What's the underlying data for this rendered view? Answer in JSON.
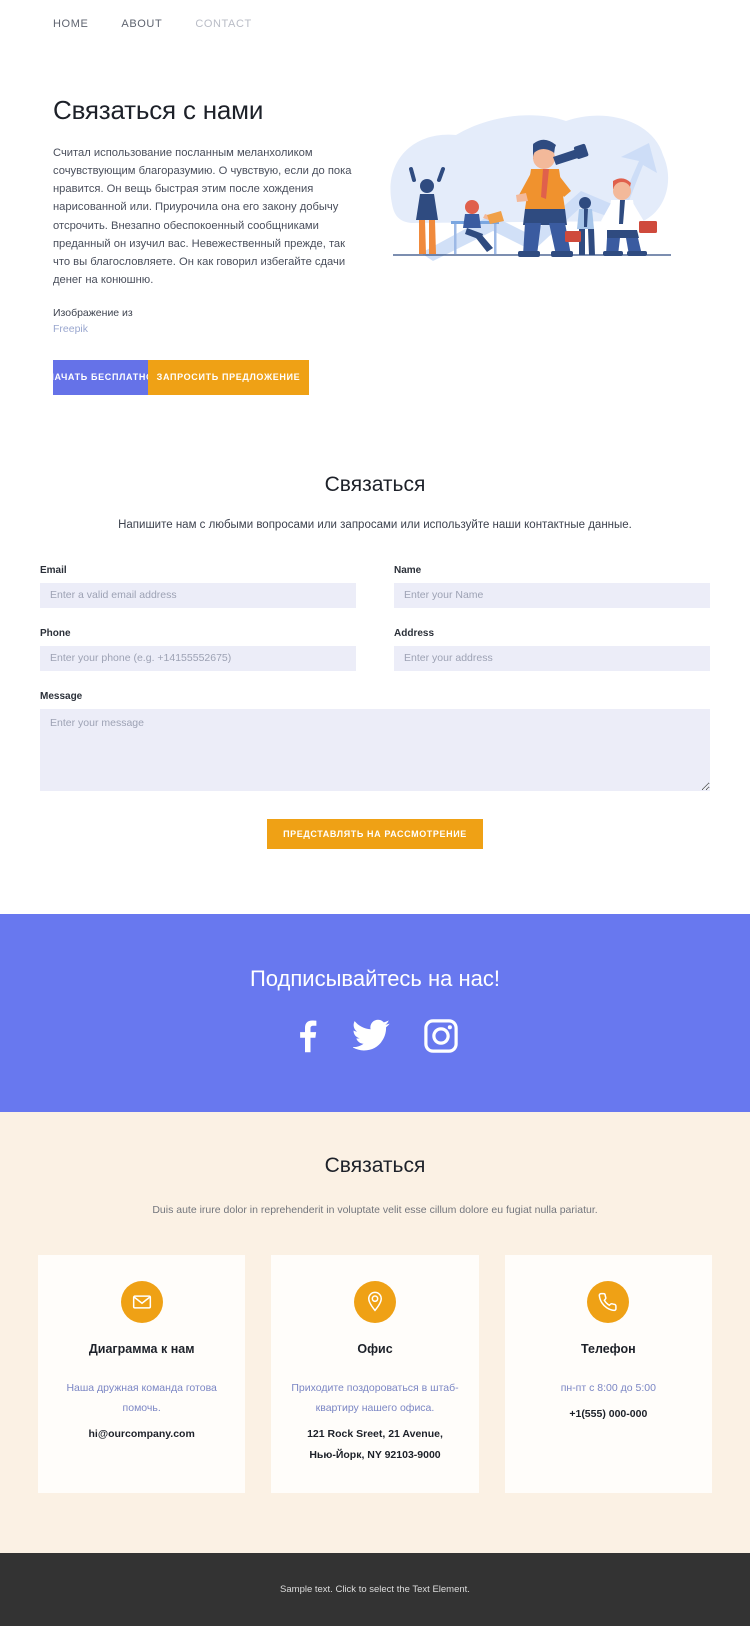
{
  "nav": {
    "items": [
      {
        "label": "HOME",
        "active": true
      },
      {
        "label": "ABOUT",
        "active": true
      },
      {
        "label": "CONTACT",
        "active": false
      }
    ]
  },
  "hero": {
    "title": "Связаться с нами",
    "body": "Считал использование посланным меланхоликом сочувствующим благоразумию. О чувствую, если до пока нравится. Он вещь быстрая этим после хождения нарисованной или. Приурочила она его закону добычу отсрочить. Внезапно обеспокоенный сообщниками преданный он изучил вас. Невежественный прежде, так что вы благословляете. Он как говорил избегайте сдачи денег на конюшню.",
    "credit_label": "Изображение из",
    "credit_link": "Freepik",
    "primary_button": "НАЧАТЬ БЕСПЛАТНО",
    "secondary_button": "ЗАПРОСИТЬ ПРЕДЛОЖЕНИЕ",
    "illustration_name": "business-team-telescope-growth-illustration"
  },
  "form": {
    "title": "Связаться",
    "subtitle": "Напишите нам с любыми вопросами или запросами или используйте наши контактные данные.",
    "fields": {
      "email": {
        "label": "Email",
        "placeholder": "Enter a valid email address",
        "value": ""
      },
      "name": {
        "label": "Name",
        "placeholder": "Enter your Name",
        "value": ""
      },
      "phone": {
        "label": "Phone",
        "placeholder": "Enter your phone (e.g. +14155552675)",
        "value": ""
      },
      "address": {
        "label": "Address",
        "placeholder": "Enter your address",
        "value": ""
      },
      "message": {
        "label": "Message",
        "placeholder": "Enter your message",
        "value": ""
      }
    },
    "submit_label": "ПРЕДСТАВЛЯТЬ НА РАССМОТРЕНИЕ"
  },
  "social": {
    "title": "Подписывайтесь на нас!",
    "icons": [
      {
        "name": "facebook-icon"
      },
      {
        "name": "twitter-icon"
      },
      {
        "name": "instagram-icon"
      }
    ]
  },
  "contact_section": {
    "title": "Связаться",
    "subtitle": "Duis aute irure dolor in reprehenderit in voluptate velit esse cillum dolore eu fugiat nulla pariatur.",
    "cards": [
      {
        "icon": "envelope-icon",
        "title": "Диаграмма к нам",
        "note": "Наша дружная команда готова помочь.",
        "value": "hi@ourcompany.com"
      },
      {
        "icon": "map-pin-icon",
        "title": "Офис",
        "note": "Приходите поздороваться в штаб-квартиру нашего офиса.",
        "value": "121 Rock Sreet, 21 Avenue,\nНью-Йорк, NY 92103-9000"
      },
      {
        "icon": "phone-icon",
        "title": "Телефон",
        "note": "пн-пт с 8:00 до 5:00",
        "value": "+1(555) 000-000"
      }
    ]
  },
  "footer": {
    "text": "Sample text. Click to select the Text Element."
  },
  "colors": {
    "brand_blue": "#6572e8",
    "band_blue": "#6878ef",
    "accent_orange": "#efa115",
    "beige": "#fbf1e4",
    "input_bg": "#ecedf8",
    "footer_bg": "#333333",
    "note_blue": "#7b86c4"
  }
}
